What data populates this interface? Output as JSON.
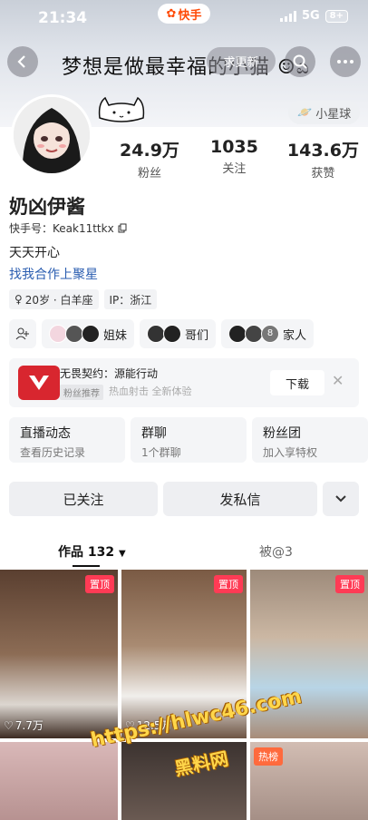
{
  "status": {
    "time": "21:34",
    "app_name": "快手",
    "network": "5G",
    "battery": "8+"
  },
  "banner": {
    "text": "梦想是做最幸福的小猫 ☺ಎ",
    "update_btn": "求更新"
  },
  "profile": {
    "planet_tag": "小星球",
    "stats": [
      {
        "num": "24.9万",
        "label": "粉丝"
      },
      {
        "num": "1035",
        "label": "关注"
      },
      {
        "num": "143.6万",
        "label": "获赞"
      }
    ],
    "nickname": "奶凶伊酱",
    "kuaishou_id": "快手号：Keak11ttkx",
    "bio": "天天开心",
    "cooperation": "找我合作上聚星",
    "tags": [
      "20岁 · 白羊座",
      "IP：浙江"
    ]
  },
  "groups": [
    {
      "label": "姐妹",
      "colors": [
        "#f3d6df",
        "#555",
        "#222"
      ]
    },
    {
      "label": "哥们",
      "colors": [
        "#333",
        "#222"
      ]
    },
    {
      "label": "家人",
      "colors": [
        "#222",
        "#444",
        "#777"
      ],
      "count": "8"
    }
  ],
  "ad": {
    "title": "无畏契约：源能行动",
    "badge": "粉丝推荐",
    "sub": "热血射击 全新体验",
    "download": "下载"
  },
  "features": [
    {
      "title": "直播动态",
      "sub": "查看历史记录"
    },
    {
      "title": "群聊",
      "sub": "1个群聊"
    },
    {
      "title": "粉丝团",
      "sub": "加入享特权"
    }
  ],
  "actions": {
    "followed": "已关注",
    "message": "发私信"
  },
  "tabs": {
    "works": "作品 132",
    "mentioned": "被@3"
  },
  "grid": [
    {
      "pinned": "置顶",
      "likes": "7.7万",
      "bg": "#6a4e3e"
    },
    {
      "pinned": "置顶",
      "likes": "12.5万",
      "bg": "#8a6e58"
    },
    {
      "pinned": "置顶",
      "likes": "",
      "bg": "#b7a696"
    },
    {
      "hot": "",
      "bg": "#caa7a8"
    },
    {
      "hot": "",
      "bg": "#5b5049"
    },
    {
      "hot": "热榜",
      "bg": "#c9b2a8"
    }
  ],
  "watermark": {
    "line1": "https://hlwc46.com",
    "line2": "黑料网"
  },
  "colors": {
    "accent": "#ff4906",
    "link": "#2a5db0",
    "badge": "#ff3b55"
  }
}
